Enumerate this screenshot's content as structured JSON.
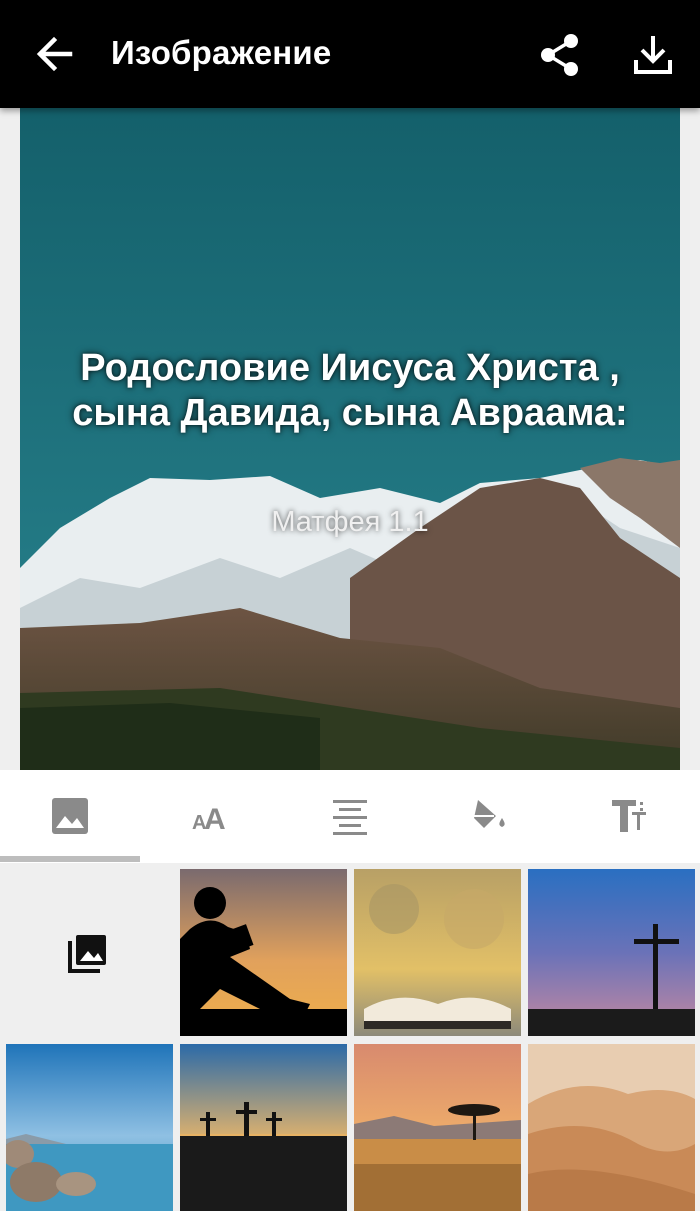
{
  "appbar": {
    "title": "Изображение",
    "back_icon": "arrow-back-icon",
    "share_icon": "share-icon",
    "download_icon": "download-icon"
  },
  "preview": {
    "verse_text": "Родословие Иисуса Христа , сына Давида, сына Авраама:",
    "reference": "Матфея 1.1"
  },
  "tabs": [
    {
      "name": "background-image",
      "icon": "image-icon",
      "selected": true
    },
    {
      "name": "font",
      "icon": "font-size-icon",
      "selected": false
    },
    {
      "name": "alignment",
      "icon": "align-center-icon",
      "selected": false
    },
    {
      "name": "color",
      "icon": "paint-bucket-icon",
      "selected": false
    },
    {
      "name": "text-style",
      "icon": "text-format-icon",
      "selected": false
    }
  ],
  "gallery": {
    "picker_icon": "photo-library-icon",
    "thumbnails": [
      "boy-reading-silhouette",
      "open-bible-bokeh",
      "cross-dusk",
      "lake-rocks",
      "three-crosses-sunset",
      "savanna-tree-sunset",
      "desert-dunes"
    ]
  },
  "colors": {
    "appbar": "#000000",
    "preview_sky": "#1d6c78",
    "tab_indicator": "#bdbdbd"
  }
}
